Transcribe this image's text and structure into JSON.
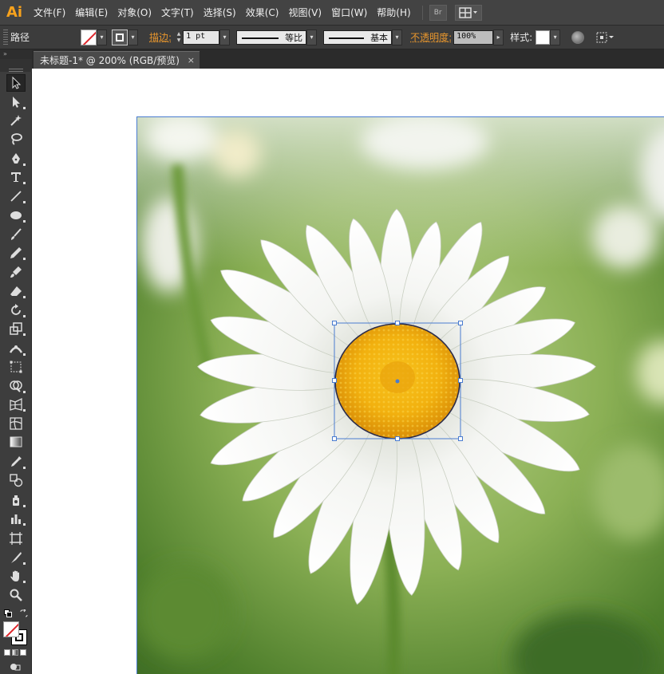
{
  "app": {
    "logo": "Ai"
  },
  "menu": {
    "items": [
      "文件(F)",
      "编辑(E)",
      "对象(O)",
      "文字(T)",
      "选择(S)",
      "效果(C)",
      "视图(V)",
      "窗口(W)",
      "帮助(H)"
    ],
    "bridge_label": "Br"
  },
  "control_bar": {
    "selection_type": "路径",
    "stroke_label": "描边:",
    "stroke_weight": "1 pt",
    "profile_label": "等比",
    "brush_label": "基本",
    "opacity_label": "不透明度:",
    "opacity_value": "100%",
    "style_label": "样式:"
  },
  "document": {
    "tab_title": "未标题-1* @ 200% (RGB/预览)",
    "close_glyph": "×"
  },
  "toolbox": {
    "collapse_glyph": "»",
    "tools": [
      "selection-tool",
      "direct-selection-tool",
      "magic-wand-tool",
      "lasso-tool",
      "pen-tool",
      "type-tool",
      "line-tool",
      "ellipse-tool",
      "paintbrush-tool",
      "pencil-tool",
      "blob-brush-tool",
      "eraser-tool",
      "rotate-tool",
      "scale-tool",
      "width-tool",
      "free-transform-tool",
      "shape-builder-tool",
      "perspective-grid-tool",
      "mesh-tool",
      "gradient-tool",
      "eyedropper-tool",
      "blend-tool",
      "symbol-sprayer-tool",
      "column-graph-tool",
      "artboard-tool",
      "slice-tool",
      "hand-tool",
      "zoom-tool"
    ]
  },
  "colors": {
    "accent": "#f7a21c",
    "selection": "#4a7cd0",
    "none_slash": "#e0262b"
  }
}
